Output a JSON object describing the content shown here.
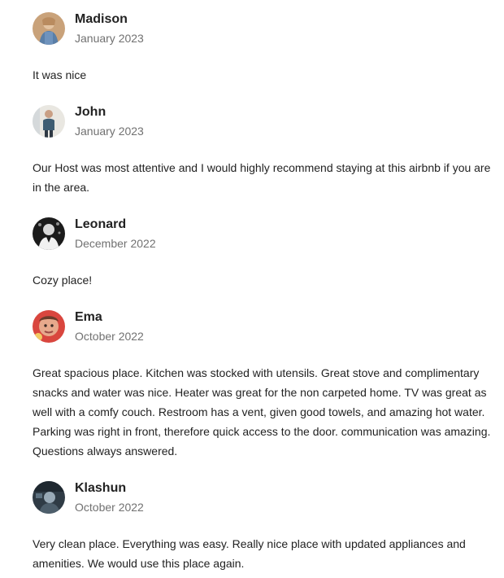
{
  "reviews": [
    {
      "name": "Madison",
      "date": "January 2023",
      "text": "It was nice",
      "avatar": {
        "icon": "user-photo-icon",
        "bg": "#c9a27a",
        "fg": "#5a7fa8"
      }
    },
    {
      "name": "John",
      "date": "January 2023",
      "text": "Our Host was most attentive and I would highly recommend staying at this airbnb if you are in the area.",
      "avatar": {
        "icon": "user-photo-icon",
        "bg": "#e9e7e1",
        "fg": "#3f5d72"
      }
    },
    {
      "name": "Leonard",
      "date": "December 2022",
      "text": "Cozy place!",
      "avatar": {
        "icon": "user-photo-icon",
        "bg": "#1b1b1b",
        "fg": "#d8d8d8"
      }
    },
    {
      "name": "Ema",
      "date": "October 2022",
      "text": "Great spacious place. Kitchen was stocked with utensils. Great stove and complimentary snacks and water was nice. Heater was great for the non carpeted home. TV was great as well with a comfy couch. Restroom has a vent, given good towels, and amazing hot water. Parking was right in front, therefore quick access to the door. communication was amazing. Questions always answered.",
      "avatar": {
        "icon": "user-photo-icon",
        "bg": "#d9463e",
        "fg": "#e7a98c"
      }
    },
    {
      "name": "Klashun",
      "date": "October 2022",
      "text": "Very clean place. Everything was easy. Really nice place with updated appliances and amenities. We would use this place again.",
      "avatar": {
        "icon": "user-photo-icon",
        "bg": "#2f3b45",
        "fg": "#98a9b6"
      }
    }
  ]
}
